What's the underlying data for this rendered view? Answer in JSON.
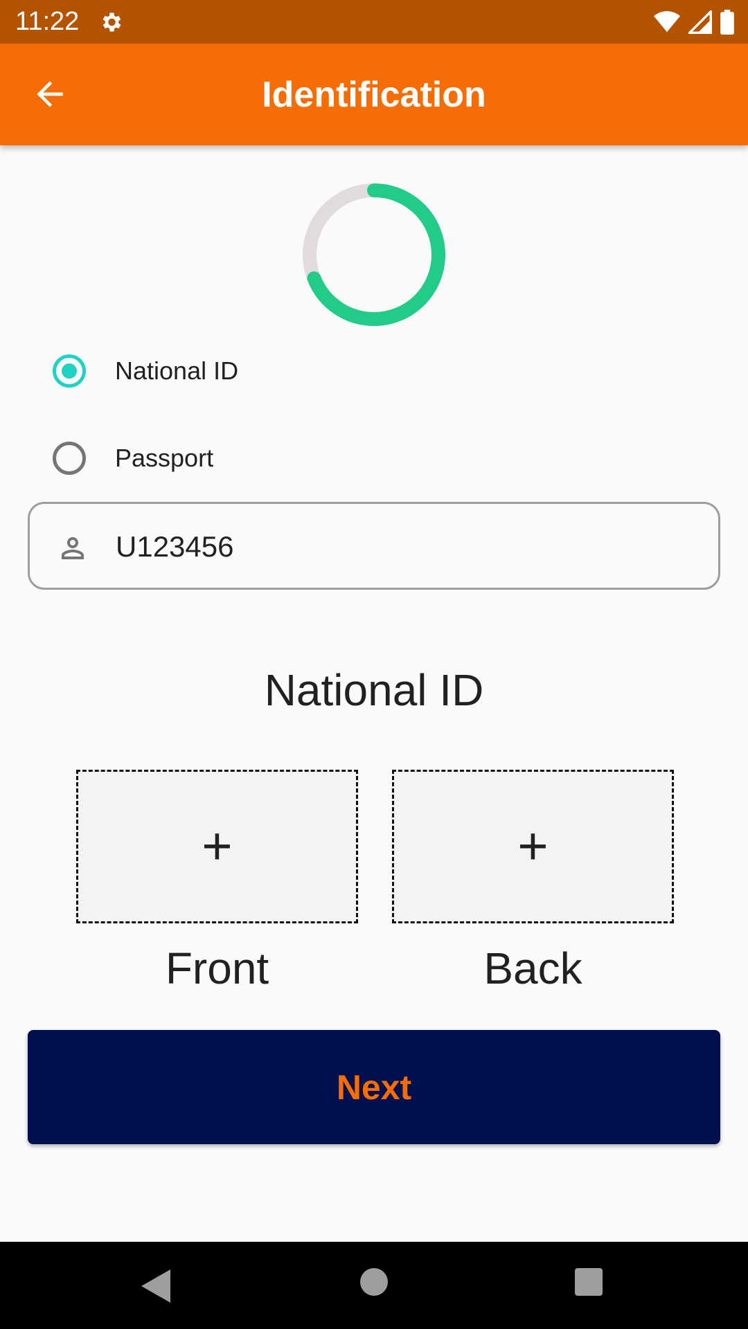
{
  "status_bar": {
    "time": "11:22"
  },
  "app_bar": {
    "title": "Identification"
  },
  "progress": {
    "fraction": 0.69,
    "track_color": "#e2dbdb",
    "fill_color": "#22cc88"
  },
  "id_type": {
    "options": [
      {
        "label": "National ID",
        "selected": true
      },
      {
        "label": "Passport",
        "selected": false
      }
    ]
  },
  "id_field": {
    "value": "U123456",
    "icon": "person-icon"
  },
  "document": {
    "title": "National ID",
    "front": {
      "plus": "+",
      "label": "Front"
    },
    "back": {
      "plus": "+",
      "label": "Back"
    }
  },
  "next_button": {
    "label": "Next"
  },
  "colors": {
    "app_bar": "#f56d04",
    "status_bar": "#b55400",
    "accent": "#1dd3c6",
    "button_bg": "#03104f",
    "button_text": "#f56d04"
  }
}
